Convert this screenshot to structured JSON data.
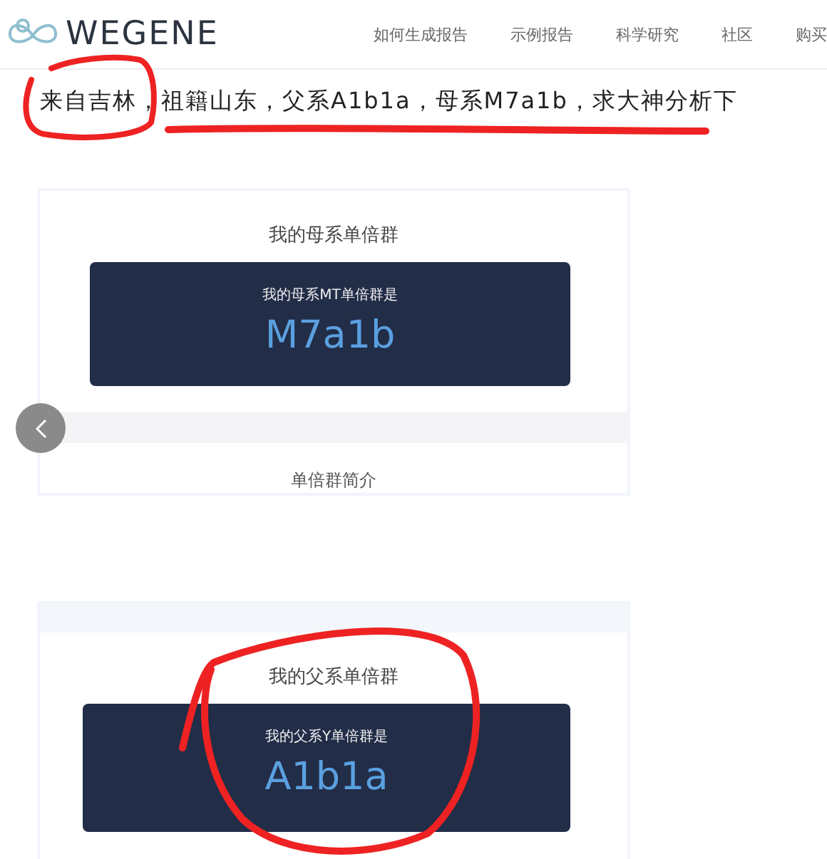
{
  "header": {
    "logo": "WEGENE",
    "nav": [
      {
        "label": "如何生成报告"
      },
      {
        "label": "示例报告"
      },
      {
        "label": "科学研究"
      },
      {
        "label": "社区"
      },
      {
        "label": "购买"
      }
    ]
  },
  "post_title": "来自吉林，祖籍山东，父系A1b1a，母系M7a1b，求大神分析下",
  "cards": [
    {
      "heading": "我的母系单倍群",
      "label": "我的母系MT单倍群是",
      "value": "M7a1b",
      "next_section": "单倍群简介"
    },
    {
      "heading": "我的父系单倍群",
      "label": "我的父系Y单倍群是",
      "value": "A1b1a"
    }
  ]
}
